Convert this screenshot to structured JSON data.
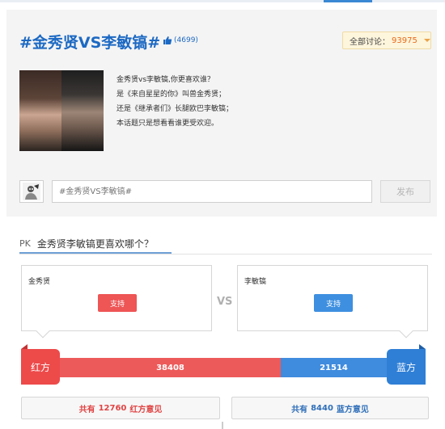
{
  "topic": {
    "title": "#金秀贤VS李敏镐#",
    "likes": "(4699)",
    "total_label": "全部讨论：",
    "total_value": "93975",
    "description": [
      "金秀贤vs李敏镐,你更喜欢谁？",
      "是《来自星星的你》叫兽金秀贤；",
      "还是《继承者们》长腿欧巴李敏镐；",
      "本话题只是想看看谁更受欢迎。"
    ],
    "post_placeholder": "#金秀贤VS李敏镐#",
    "post_button": "发布"
  },
  "pk": {
    "label": "PK",
    "question": "金秀贤李敏镐更喜欢哪个？",
    "vs": "VS",
    "red": {
      "name": "金秀贤",
      "support": "支持",
      "side_label": "红方",
      "votes": "38408",
      "opinion_prefix": "共有",
      "opinion_count": "12760",
      "opinion_suffix": "红方意见"
    },
    "blue": {
      "name": "李敏镐",
      "support": "支持",
      "side_label": "蓝方",
      "votes": "21514",
      "opinion_prefix": "共有",
      "opinion_count": "8440",
      "opinion_suffix": "蓝方意见"
    },
    "red_share": 0.641
  },
  "colors": {
    "accent_blue": "#1c69c3",
    "red": "#ed5a5a",
    "blue": "#3f8bde",
    "orange": "#e96a1a"
  }
}
